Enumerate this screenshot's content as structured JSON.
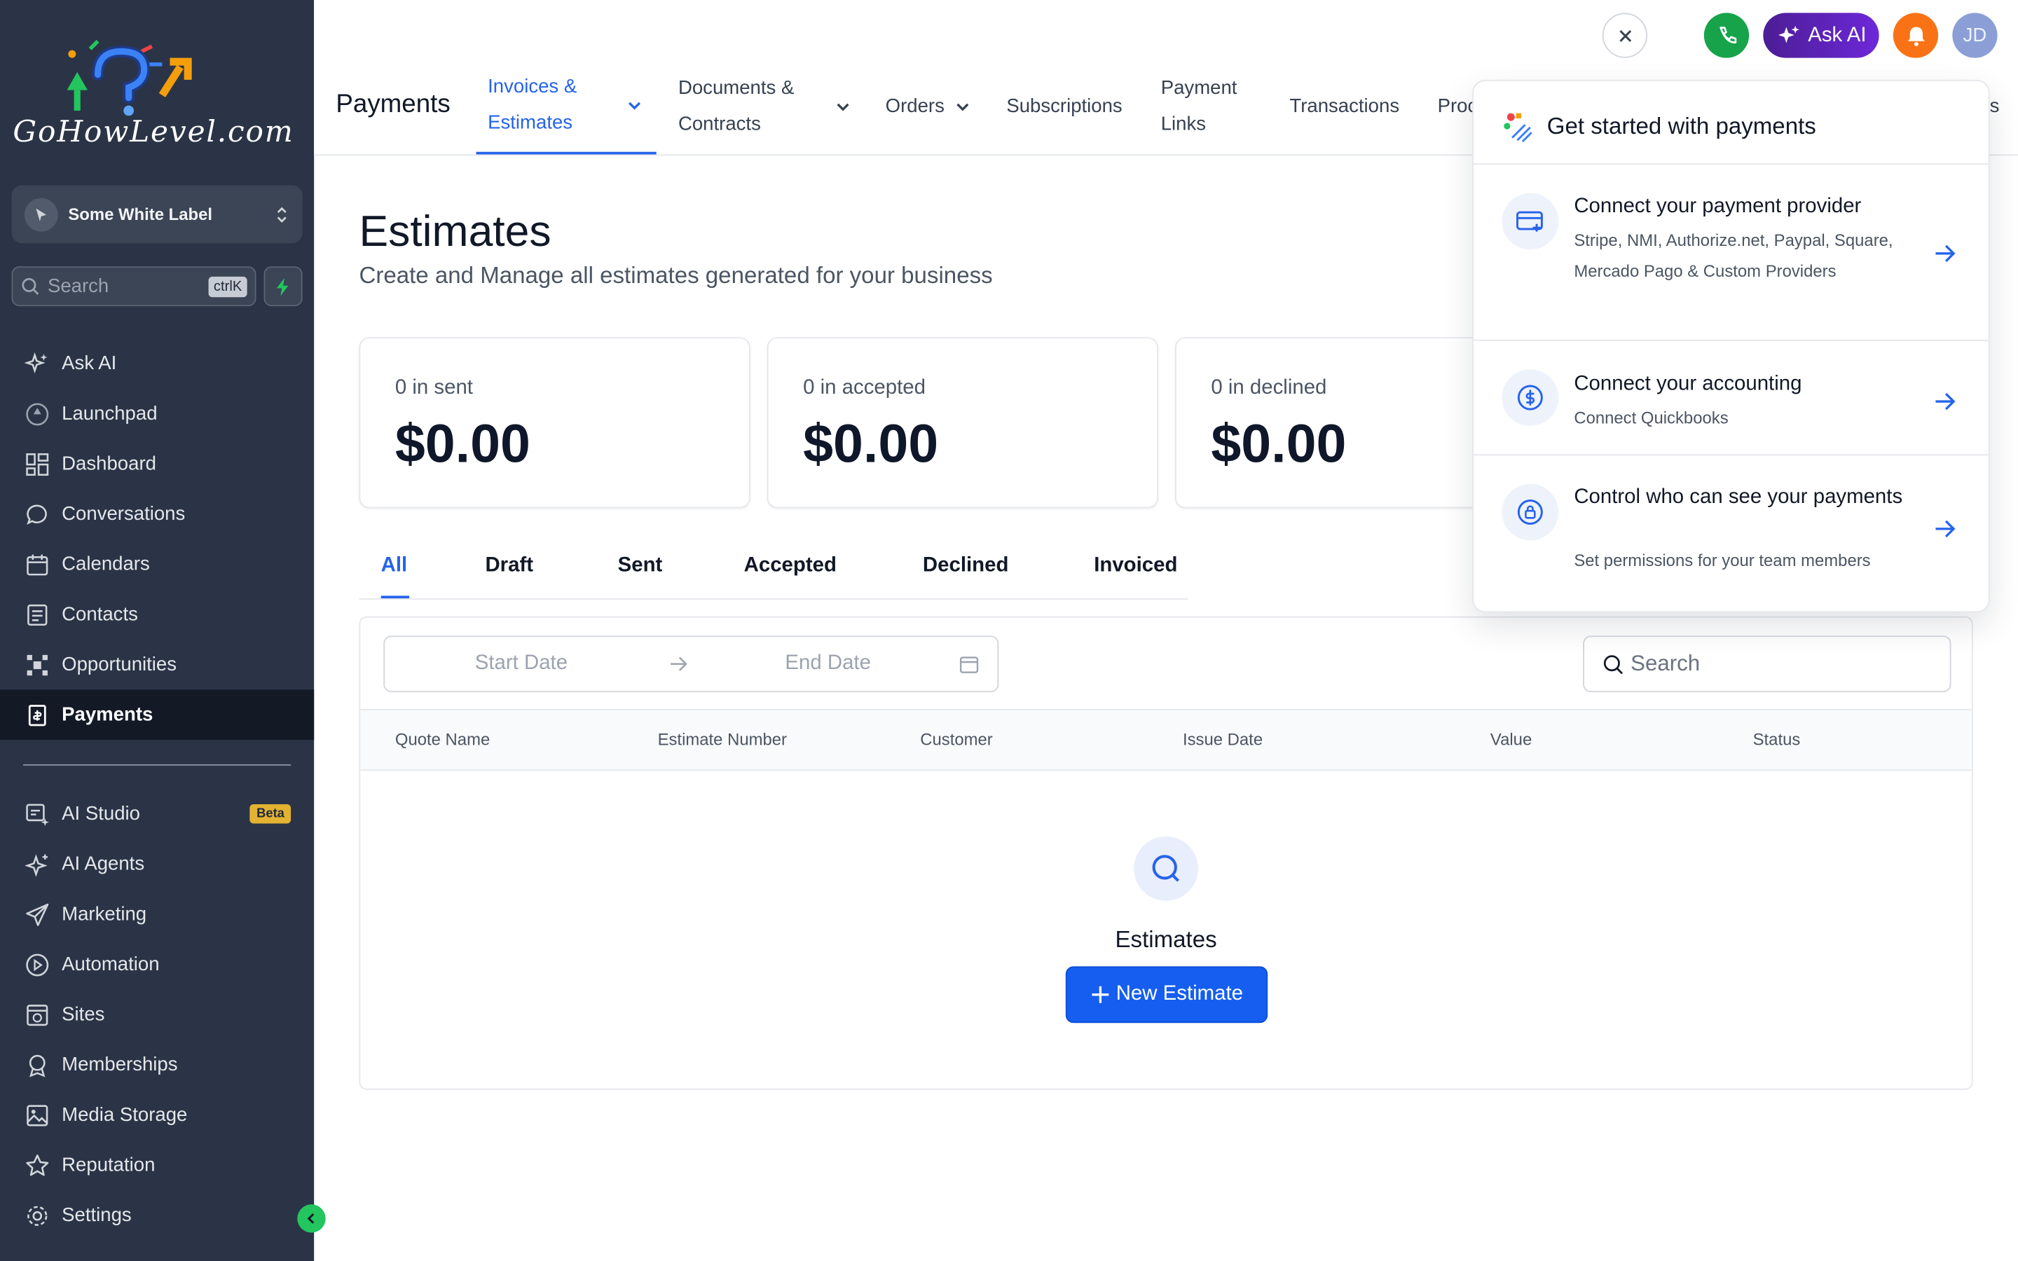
{
  "brand": {
    "logo_text": "GoHowLevel.com"
  },
  "sidebar": {
    "account_name": "Some White Label",
    "search_placeholder": "Search",
    "search_shortcut": "ctrlK",
    "items_primary": [
      {
        "label": "Ask AI",
        "icon": "sparkle-icon"
      },
      {
        "label": "Launchpad",
        "icon": "rocket-icon"
      },
      {
        "label": "Dashboard",
        "icon": "grid-icon"
      },
      {
        "label": "Conversations",
        "icon": "chat-icon"
      },
      {
        "label": "Calendars",
        "icon": "calendar-icon"
      },
      {
        "label": "Contacts",
        "icon": "contacts-icon"
      },
      {
        "label": "Opportunities",
        "icon": "opportunities-icon"
      },
      {
        "label": "Payments",
        "icon": "payments-icon",
        "active": true
      }
    ],
    "items_secondary": [
      {
        "label": "AI Studio",
        "icon": "ai-studio-icon",
        "badge": "Beta"
      },
      {
        "label": "AI Agents",
        "icon": "ai-agents-icon"
      },
      {
        "label": "Marketing",
        "icon": "send-icon"
      },
      {
        "label": "Automation",
        "icon": "automation-icon"
      },
      {
        "label": "Sites",
        "icon": "sites-icon"
      },
      {
        "label": "Memberships",
        "icon": "award-icon"
      },
      {
        "label": "Media Storage",
        "icon": "image-icon"
      },
      {
        "label": "Reputation",
        "icon": "star-icon"
      },
      {
        "label": "Settings",
        "icon": "gear-icon"
      }
    ]
  },
  "header": {
    "title": "Payments",
    "tabs": [
      {
        "line1": "Invoices &",
        "line2": "Estimates",
        "active": true
      },
      {
        "line1": "Documents &",
        "line2": "Contracts"
      },
      {
        "line1": "Orders"
      },
      {
        "line1": "Subscriptions"
      },
      {
        "line1": "Payment",
        "line2": "Links"
      },
      {
        "line1": "Transactions"
      },
      {
        "line1": "Proc"
      },
      {
        "line1": "s"
      }
    ],
    "ask_ai_label": "Ask AI",
    "avatar_initials": "JD"
  },
  "main": {
    "title": "Estimates",
    "subtitle": "Create and Manage all estimates generated for your business",
    "stats": [
      {
        "label": "0 in sent",
        "value": "$0.00"
      },
      {
        "label": "0 in accepted",
        "value": "$0.00"
      },
      {
        "label": "0 in declined",
        "value": "$0.00"
      }
    ],
    "status_tabs": [
      "All",
      "Draft",
      "Sent",
      "Accepted",
      "Declined",
      "Invoiced"
    ],
    "date_start_placeholder": "Start Date",
    "date_end_placeholder": "End Date",
    "search_placeholder": "Search",
    "columns": [
      "Quote Name",
      "Estimate Number",
      "Customer",
      "Issue Date",
      "Value",
      "Status"
    ],
    "empty_title": "Estimates",
    "new_button": "New Estimate"
  },
  "popover": {
    "title": "Get started with payments",
    "items": [
      {
        "title": "Connect your payment provider",
        "description": "Stripe, NMI, Authorize.net, Paypal, Square, Mercado Pago & Custom Providers"
      },
      {
        "title": "Connect your accounting",
        "description": "Connect Quickbooks"
      },
      {
        "title": "Control who can see your payments",
        "description": "Set permissions for your team members"
      }
    ]
  },
  "colors": {
    "accent": "#2563eb",
    "sidebar_bg": "#2a3446",
    "primary_button": "#155eef"
  }
}
